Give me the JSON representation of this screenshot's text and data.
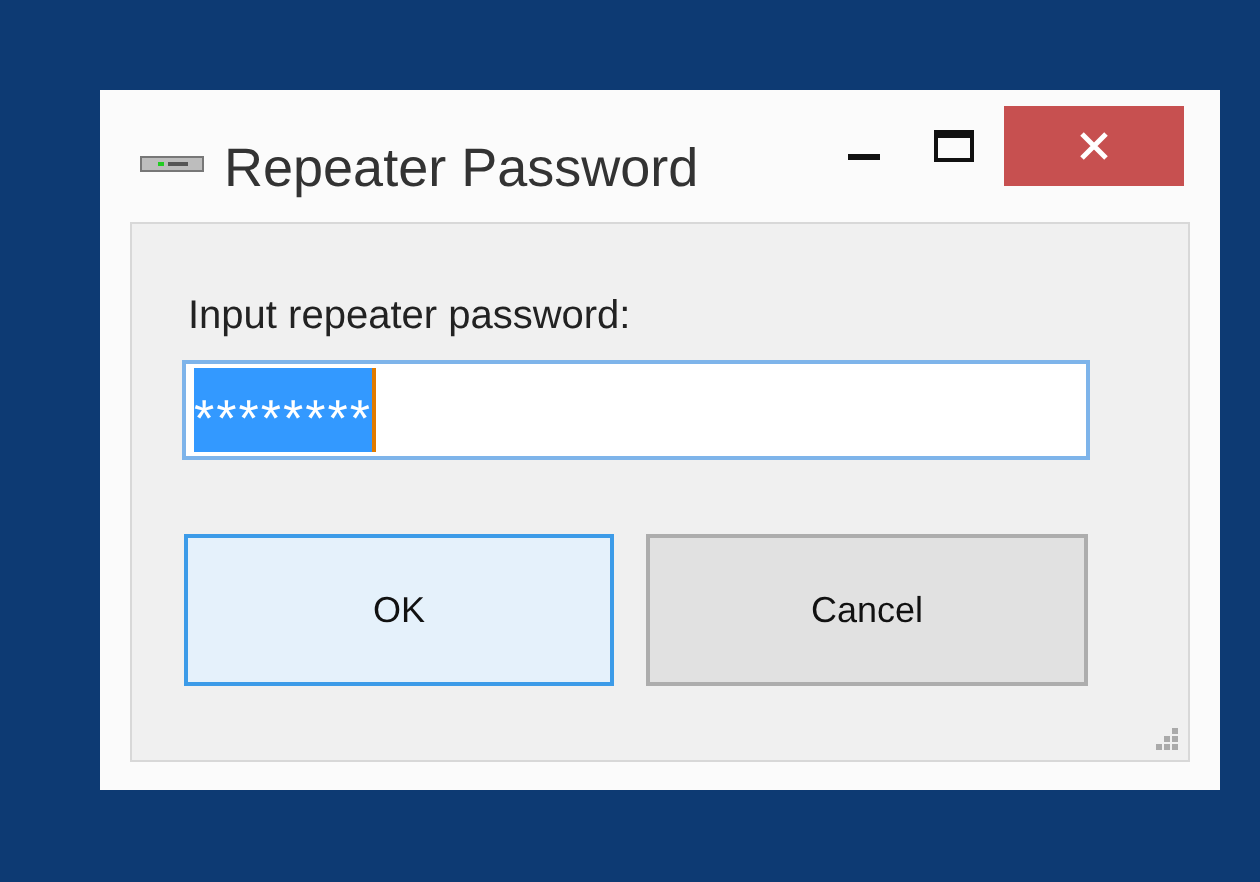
{
  "window": {
    "title": "Repeater Password"
  },
  "prompt": {
    "label": "Input repeater password:"
  },
  "password_field": {
    "value": "********",
    "selected": true
  },
  "buttons": [
    {
      "label": "OK",
      "focused": true
    },
    {
      "label": "Cancel",
      "focused": false
    }
  ]
}
